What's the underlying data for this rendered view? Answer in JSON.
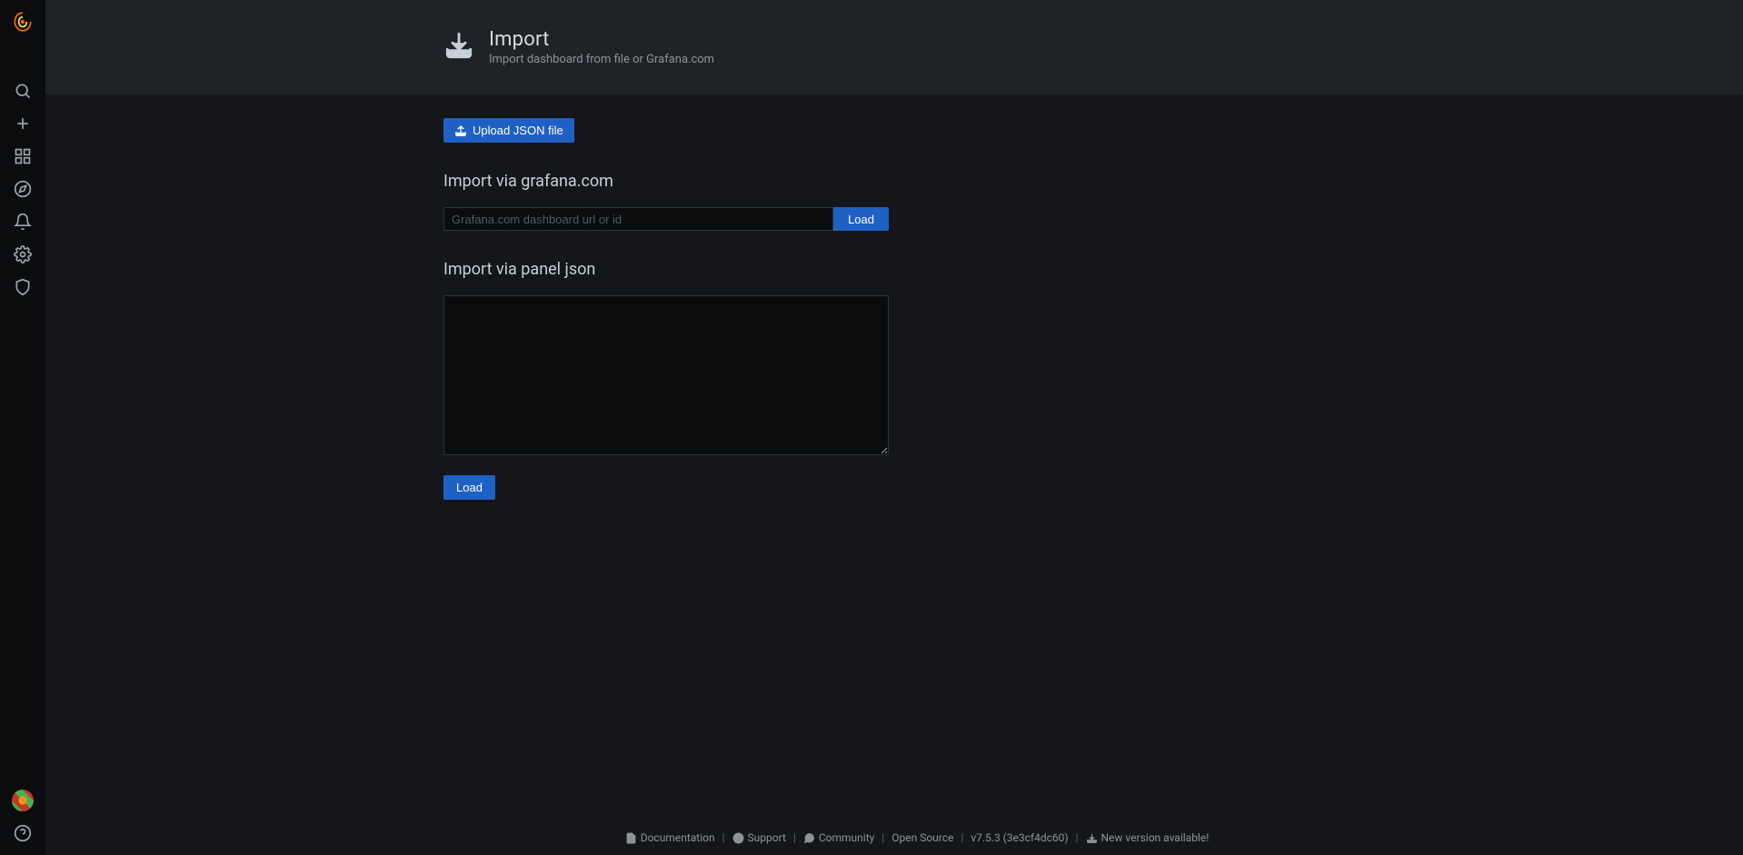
{
  "page": {
    "title": "Import",
    "subtitle": "Import dashboard from file or Grafana.com"
  },
  "upload_button": {
    "label": "Upload JSON file"
  },
  "section_url": {
    "heading": "Import via grafana.com",
    "placeholder": "Grafana.com dashboard url or id",
    "value": "",
    "load_label": "Load"
  },
  "section_json": {
    "heading": "Import via panel json",
    "value": "",
    "load_label": "Load"
  },
  "footer": {
    "documentation": "Documentation",
    "support": "Support",
    "community": "Community",
    "open_source": "Open Source",
    "version": "v7.5.3 (3e3cf4dc60)",
    "new_version": "New version available!"
  }
}
